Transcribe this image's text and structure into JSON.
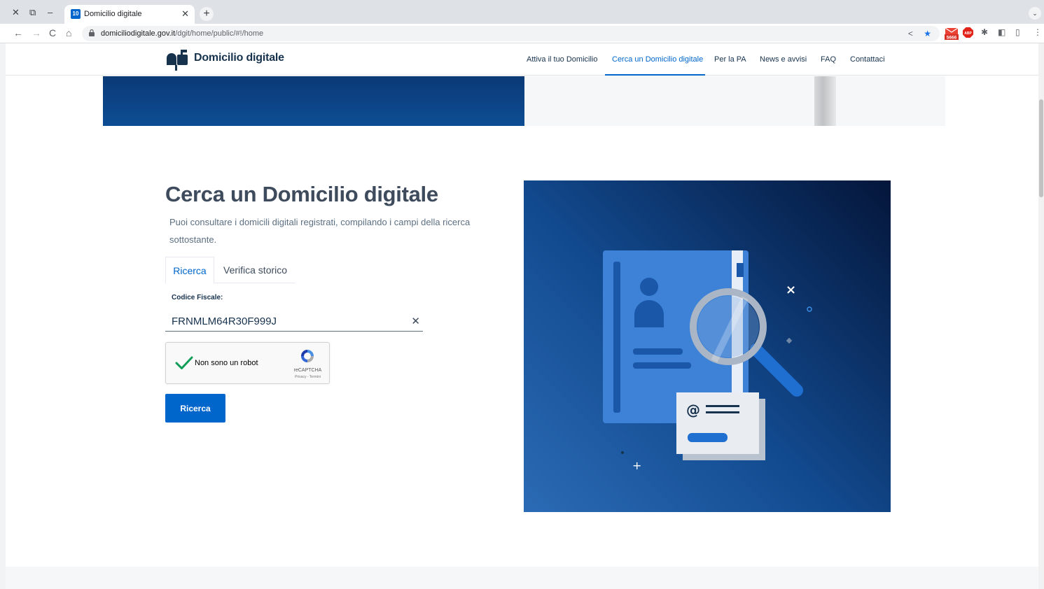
{
  "browser": {
    "window_controls": {
      "close": "✕",
      "restore": "⧉",
      "minimize": "–"
    },
    "tab": {
      "title": "Domicilio digitale",
      "favicon_text": "10",
      "close": "✕"
    },
    "new_tab": "+",
    "tab_menu": "⌄",
    "url_host": "domiciliodigitale.gov.it",
    "url_path": "/dgit/home/public/#!/home",
    "extension_badge": "5666",
    "abp_label": "ABP"
  },
  "header": {
    "brand": "Domicilio digitale",
    "nav": [
      {
        "label": "Attiva il tuo Domicilio",
        "active": false
      },
      {
        "label": "Cerca un Domicilio digitale",
        "active": true
      },
      {
        "label": "Per la PA",
        "active": false
      },
      {
        "label": "News e avvisi",
        "active": false
      },
      {
        "label": "FAQ",
        "active": false
      },
      {
        "label": "Contattaci",
        "active": false
      }
    ]
  },
  "main": {
    "title": "Cerca un Domicilio digitale",
    "lead": "Puoi consultare i domicili digitali registrati, compilando i campi della ricerca sottostante.",
    "tabs": [
      {
        "label": "Ricerca",
        "active": true
      },
      {
        "label": "Verifica storico",
        "active": false
      }
    ],
    "field_label": "Codice Fiscale:",
    "field_value": "FRNMLM64R30F999J",
    "clear_icon": "✕",
    "captcha": {
      "label": "Non sono un robot",
      "brand": "reCAPTCHA",
      "terms": "Privacy - Termini",
      "checked": true
    },
    "search_button": "Ricerca"
  },
  "colors": {
    "primary": "#0066cc",
    "heading": "#3d4b5c",
    "text_muted": "#5c6f82",
    "navy": "#17324d"
  }
}
